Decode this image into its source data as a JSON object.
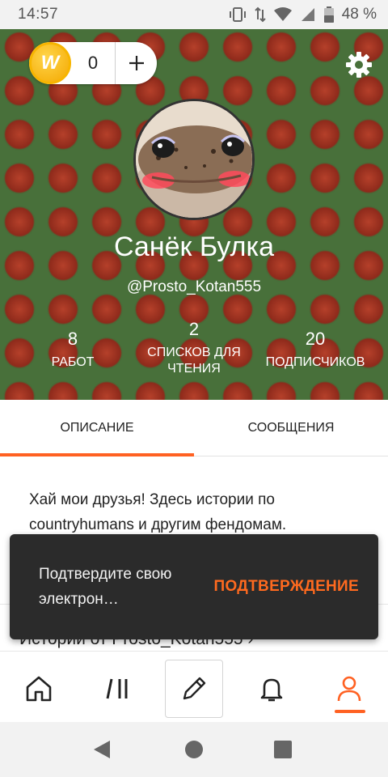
{
  "status_bar": {
    "time": "14:57",
    "battery": "48 %",
    "icons": [
      "vibrate-icon",
      "data-arrows-icon",
      "wifi-icon",
      "signal-icon",
      "battery-icon"
    ]
  },
  "header": {
    "coins": "0",
    "add_label": "+",
    "coin_letter": "W",
    "name": "Санёк Булка",
    "handle": "@Prosto_Kotan555",
    "stats": {
      "works": {
        "value": "8",
        "label": "РАБОТ"
      },
      "lists": {
        "value": "2",
        "label": "СПИСКОВ ДЛЯ ЧТЕНИЯ"
      },
      "followers": {
        "value": "20",
        "label": "ПОДПИСЧИКОВ"
      }
    }
  },
  "tabs": [
    {
      "label": "ОПИСАНИЕ",
      "active": true
    },
    {
      "label": "СООБЩЕНИЯ",
      "active": false
    }
  ],
  "content": {
    "description": "Хай мои друзья! Здесь истории по countryhumans и другим фендомам.",
    "stories_link": "Истории от Prosto_Kotan555 ›"
  },
  "snackbar": {
    "message": "Подтвердите свою электрон…",
    "action": "ПОДТВЕРЖДЕНИЕ"
  },
  "bottom_nav": [
    "home-icon",
    "library-icon",
    "write-icon",
    "bell-icon",
    "profile-icon"
  ],
  "colors": {
    "accent": "#ff6122",
    "header_green": "#48703a",
    "snackbar": "#2b2b2b",
    "coin": "#f4a800"
  }
}
